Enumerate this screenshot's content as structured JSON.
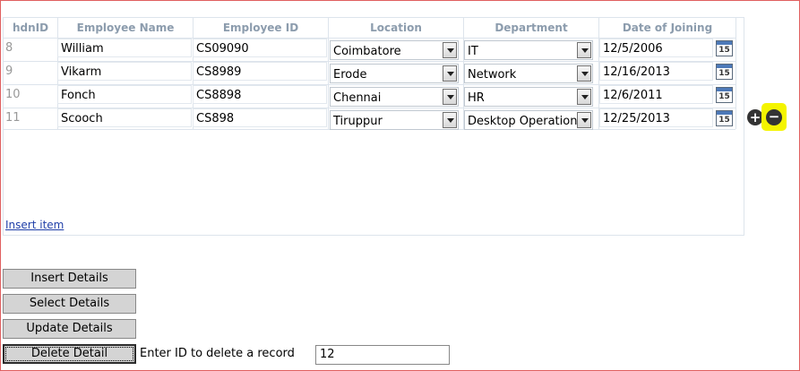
{
  "columns": [
    "hdnID",
    "Employee Name",
    "Employee ID",
    "Location",
    "Department",
    "Date of Joining"
  ],
  "rows": [
    {
      "hdn": "8",
      "name": "William",
      "emp_id": "CS09090",
      "location": "Coimbatore",
      "department": "IT",
      "doj": "12/5/2006"
    },
    {
      "hdn": "9",
      "name": "Vikarm",
      "emp_id": "CS8989",
      "location": "Erode",
      "department": "Network",
      "doj": "12/16/2013"
    },
    {
      "hdn": "10",
      "name": "Fonch",
      "emp_id": "CS8898",
      "location": "Chennai",
      "department": "HR",
      "doj": "12/6/2011"
    },
    {
      "hdn": "11",
      "name": "Scooch",
      "emp_id": "CS898",
      "location": "Tiruppur",
      "department": "Desktop Operations",
      "doj": "12/25/2013"
    }
  ],
  "calendar_day": "15",
  "add_symbol": "+",
  "remove_symbol": "−",
  "insert_item_link": "Insert item",
  "buttons": {
    "insert": "Insert Details",
    "select": "Select Details",
    "update": "Update Details",
    "delete": "Delete Detail"
  },
  "delete_label": "Enter ID to delete a record",
  "delete_id_value": "12",
  "highlight_color": "#f4f400"
}
